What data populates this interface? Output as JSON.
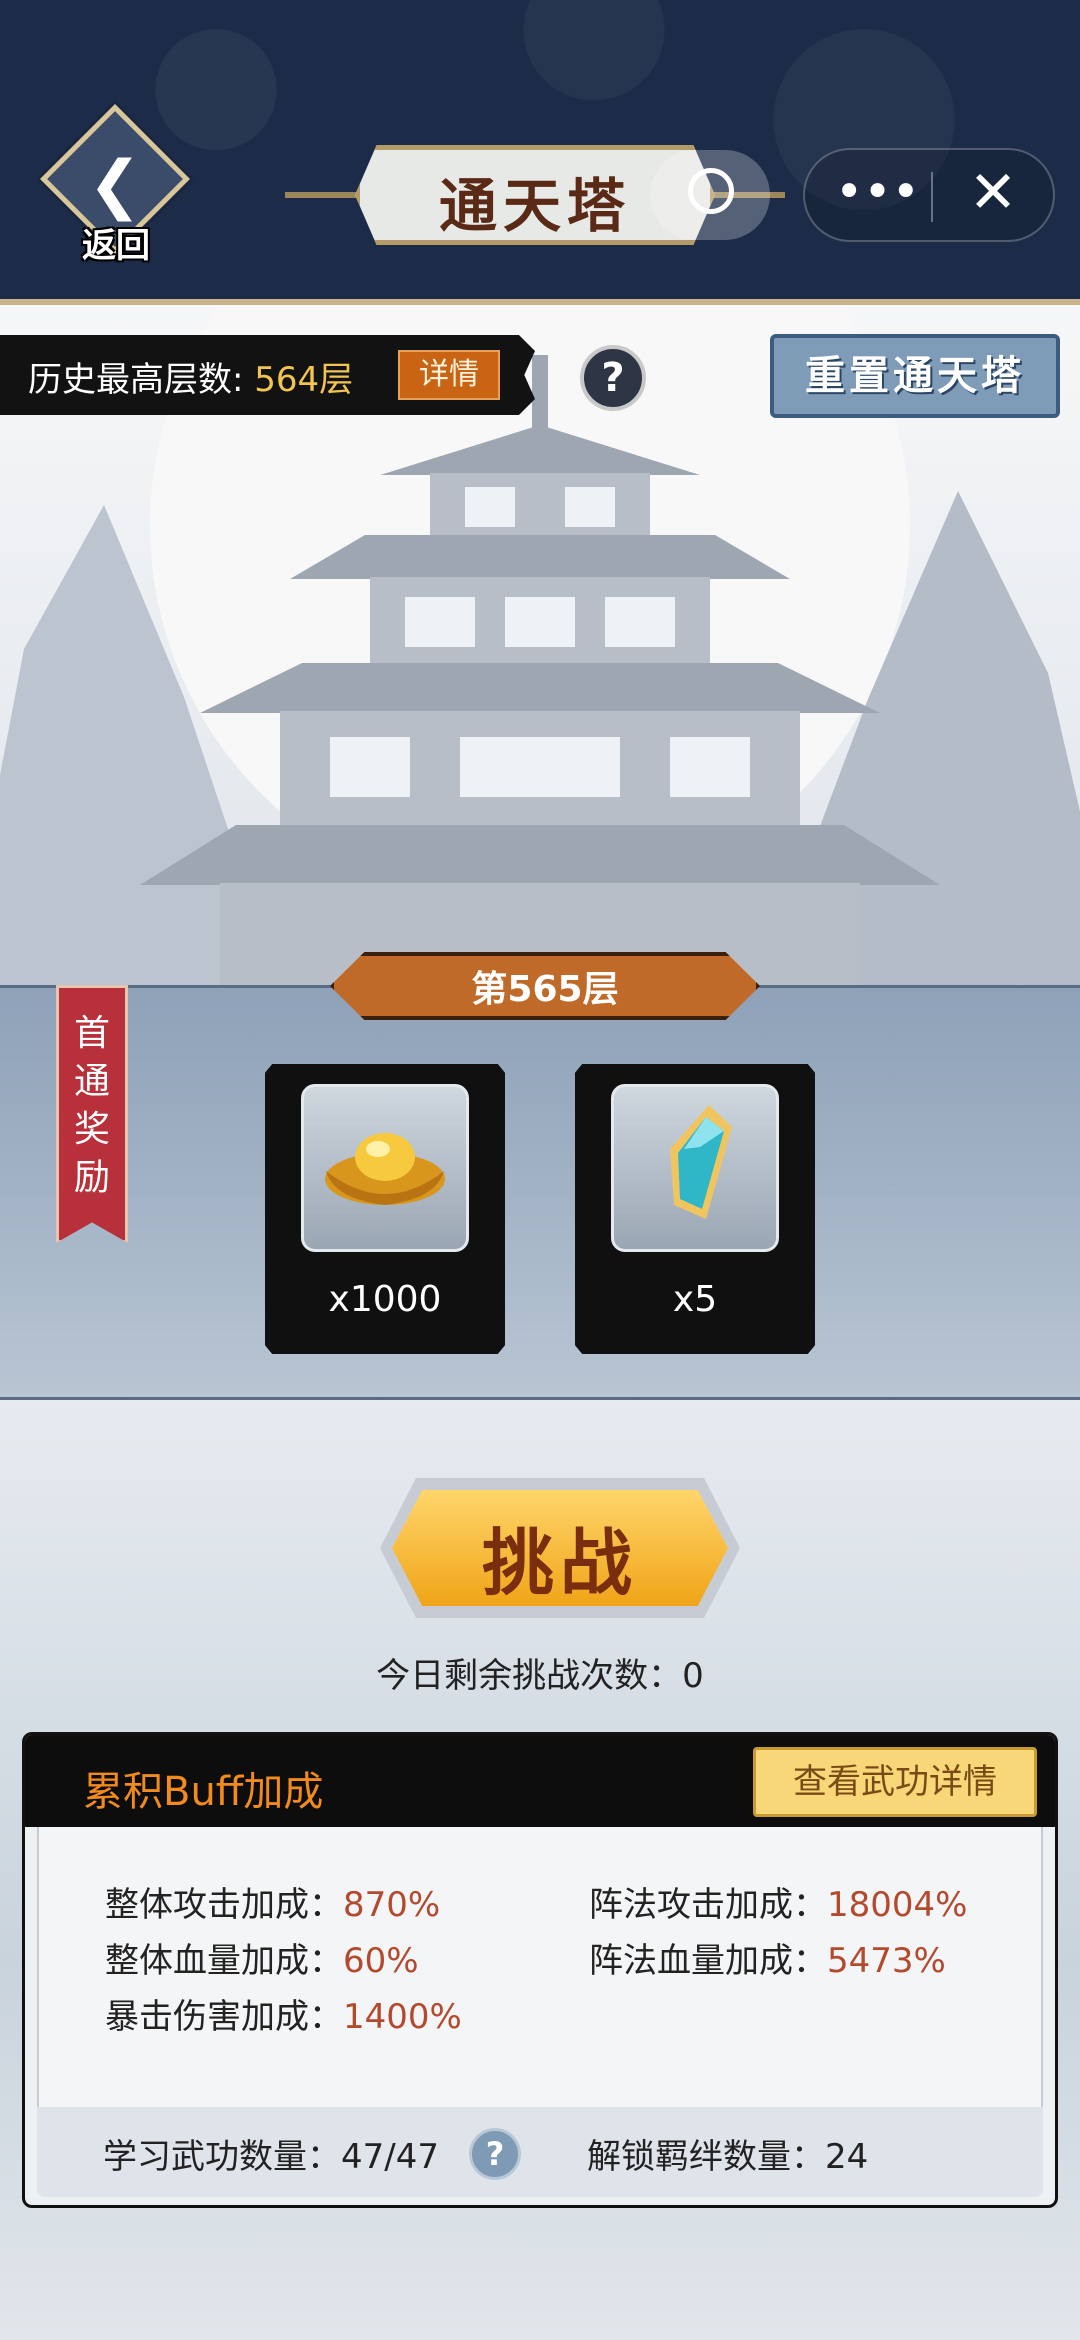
{
  "header": {
    "back_label": "返回",
    "title": "通天塔",
    "more_icon": "ellipsis-icon",
    "close_icon": "close-icon",
    "bg_color": "#1c2c48"
  },
  "stats": {
    "best_label": "历史最高层数:",
    "best_value": "564层",
    "detail_label": "详情",
    "help_glyph": "?",
    "reset_label": "重置通天塔"
  },
  "floor": {
    "label": "第565层",
    "ribbon_label": "首通奖励"
  },
  "rewards": [
    {
      "icon": "gold-ingot-icon",
      "qty": "x1000"
    },
    {
      "icon": "crystal-shard-icon",
      "qty": "x5"
    }
  ],
  "challenge": {
    "label": "挑战",
    "remaining": "今日剩余挑战次数：0",
    "accent": "#f0a418"
  },
  "buff": {
    "title": "累积Buff加成",
    "detail_label": "查看武功详情",
    "rows": [
      {
        "label": "整体攻击加成：",
        "value": "870%"
      },
      {
        "label": "阵法攻击加成：",
        "value": "18004%"
      },
      {
        "label": "整体血量加成：",
        "value": "60%"
      },
      {
        "label": "阵法血量加成：",
        "value": "5473%"
      },
      {
        "label": "暴击伤害加成：",
        "value": "1400%"
      }
    ],
    "learned_label": "学习武功数量：47/47",
    "unlocked_label": "解锁羁绊数量：24",
    "help_glyph": "?"
  }
}
